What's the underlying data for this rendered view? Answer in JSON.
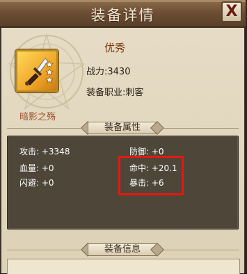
{
  "window": {
    "title": "装备详情",
    "close_label": "X"
  },
  "item": {
    "name": "暗影之殇",
    "quality": "优秀",
    "stars": 3,
    "icon": "dagger-icon",
    "power_label": "战力:",
    "power_value": "3430",
    "class_label": "装备职业:",
    "class_value": "刺客"
  },
  "sections": {
    "attributes_title": "装备属性",
    "info_title": "装备信息"
  },
  "stats": {
    "attack": "攻击: +3348",
    "defense": "防御: +0",
    "hp": "血量: +0",
    "hit": "命中: +20.1",
    "dodge": "闪避: +0",
    "crit": "暴击: +6"
  },
  "colors": {
    "title_bar": "#6d4f35",
    "panel": "#4d4639",
    "highlight": "#e8170f",
    "quality_text": "#7a3a10"
  }
}
